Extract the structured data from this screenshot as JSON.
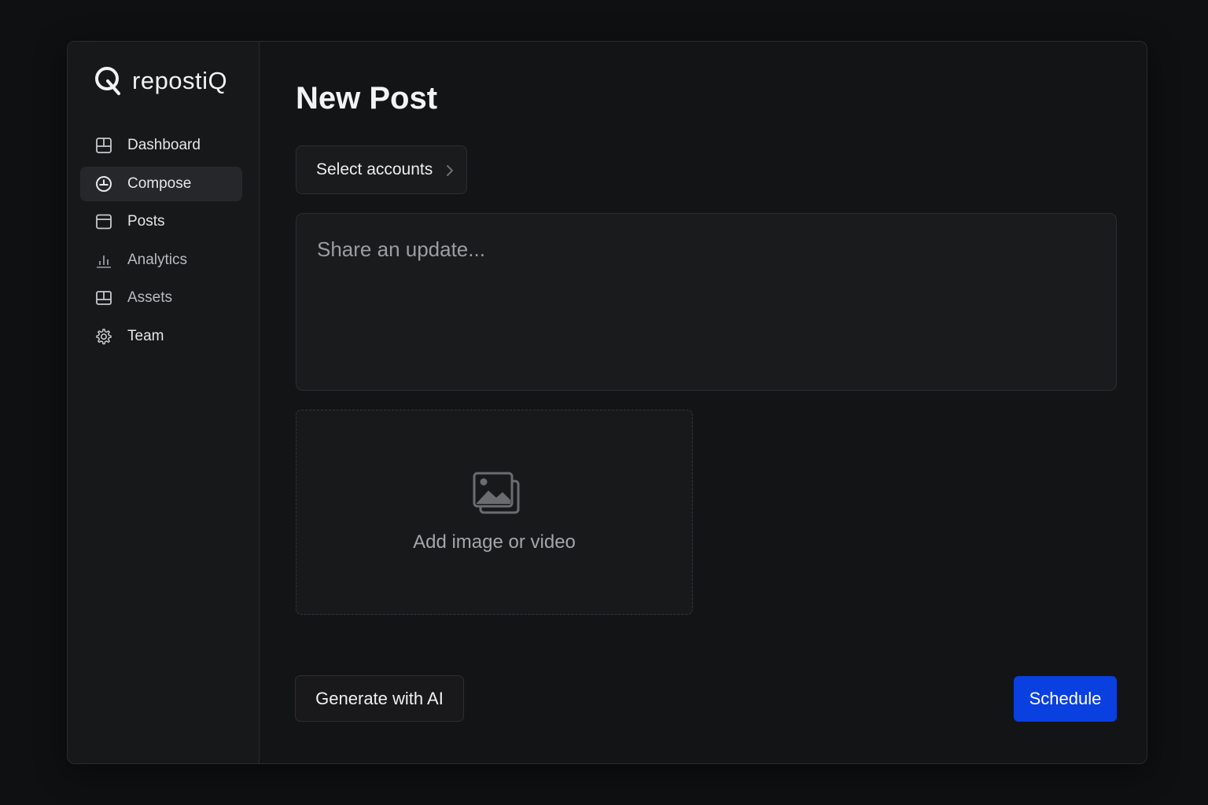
{
  "brand": {
    "name": "repostiQ",
    "logo_icon": "q-logo-icon"
  },
  "sidebar": {
    "items": [
      {
        "label": "Dashboard",
        "icon": "dashboard-icon",
        "active": false
      },
      {
        "label": "Compose",
        "icon": "compose-icon",
        "active": true
      },
      {
        "label": "Posts",
        "icon": "posts-icon",
        "active": false
      },
      {
        "label": "Analytics",
        "icon": "analytics-icon",
        "active": false
      },
      {
        "label": "Assets",
        "icon": "assets-icon",
        "active": false
      },
      {
        "label": "Team",
        "icon": "gear-icon",
        "active": false
      }
    ]
  },
  "main": {
    "title": "New Post",
    "select_accounts_label": "Select accounts",
    "composer_placeholder": "Share an update...",
    "composer_value": "",
    "media_label": "Add image or video",
    "generate_ai_label": "Generate with AI",
    "schedule_label": "Schedule"
  },
  "colors": {
    "background": "#0f1011",
    "panel": "#131416",
    "sidebar": "#17181a",
    "accent": "#0a3fe0",
    "text": "#e9e9ea",
    "muted_text": "#a4a5a9"
  }
}
